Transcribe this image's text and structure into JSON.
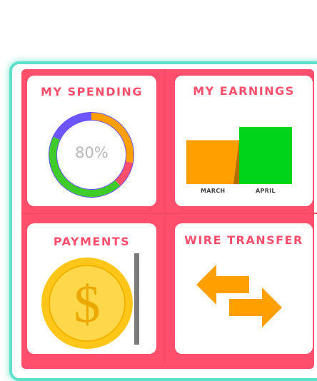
{
  "tiles": {
    "spending": {
      "title": "MY SPENDING",
      "percent_label": "80%",
      "progress": 0.8
    },
    "earnings": {
      "title": "MY EARNINGS"
    },
    "payments": {
      "title": "PAYMENTS"
    },
    "wire": {
      "title": "WIRE TRANSFER"
    }
  },
  "chart_data": {
    "type": "bar",
    "categories": [
      "MARCH",
      "APRIL"
    ],
    "values": [
      60,
      78
    ],
    "colors": [
      "#ff9f00",
      "#00d41a"
    ]
  },
  "donut_segments": [
    {
      "color": "#ff9f00",
      "fraction": 0.28
    },
    {
      "color": "#ff4f6c",
      "fraction": 0.1
    },
    {
      "color": "#3fcc2a",
      "fraction": 0.44
    },
    {
      "color": "#6a55ff",
      "fraction": 0.18
    }
  ],
  "icons": {
    "payments": "dollar-coin-icon",
    "wire": "transfer-arrows-icon"
  },
  "colors": {
    "accent": "#ff4f6c",
    "frame": "#5fe0c8",
    "coin": "#ffc61a",
    "arrows": "#ff9f00"
  }
}
